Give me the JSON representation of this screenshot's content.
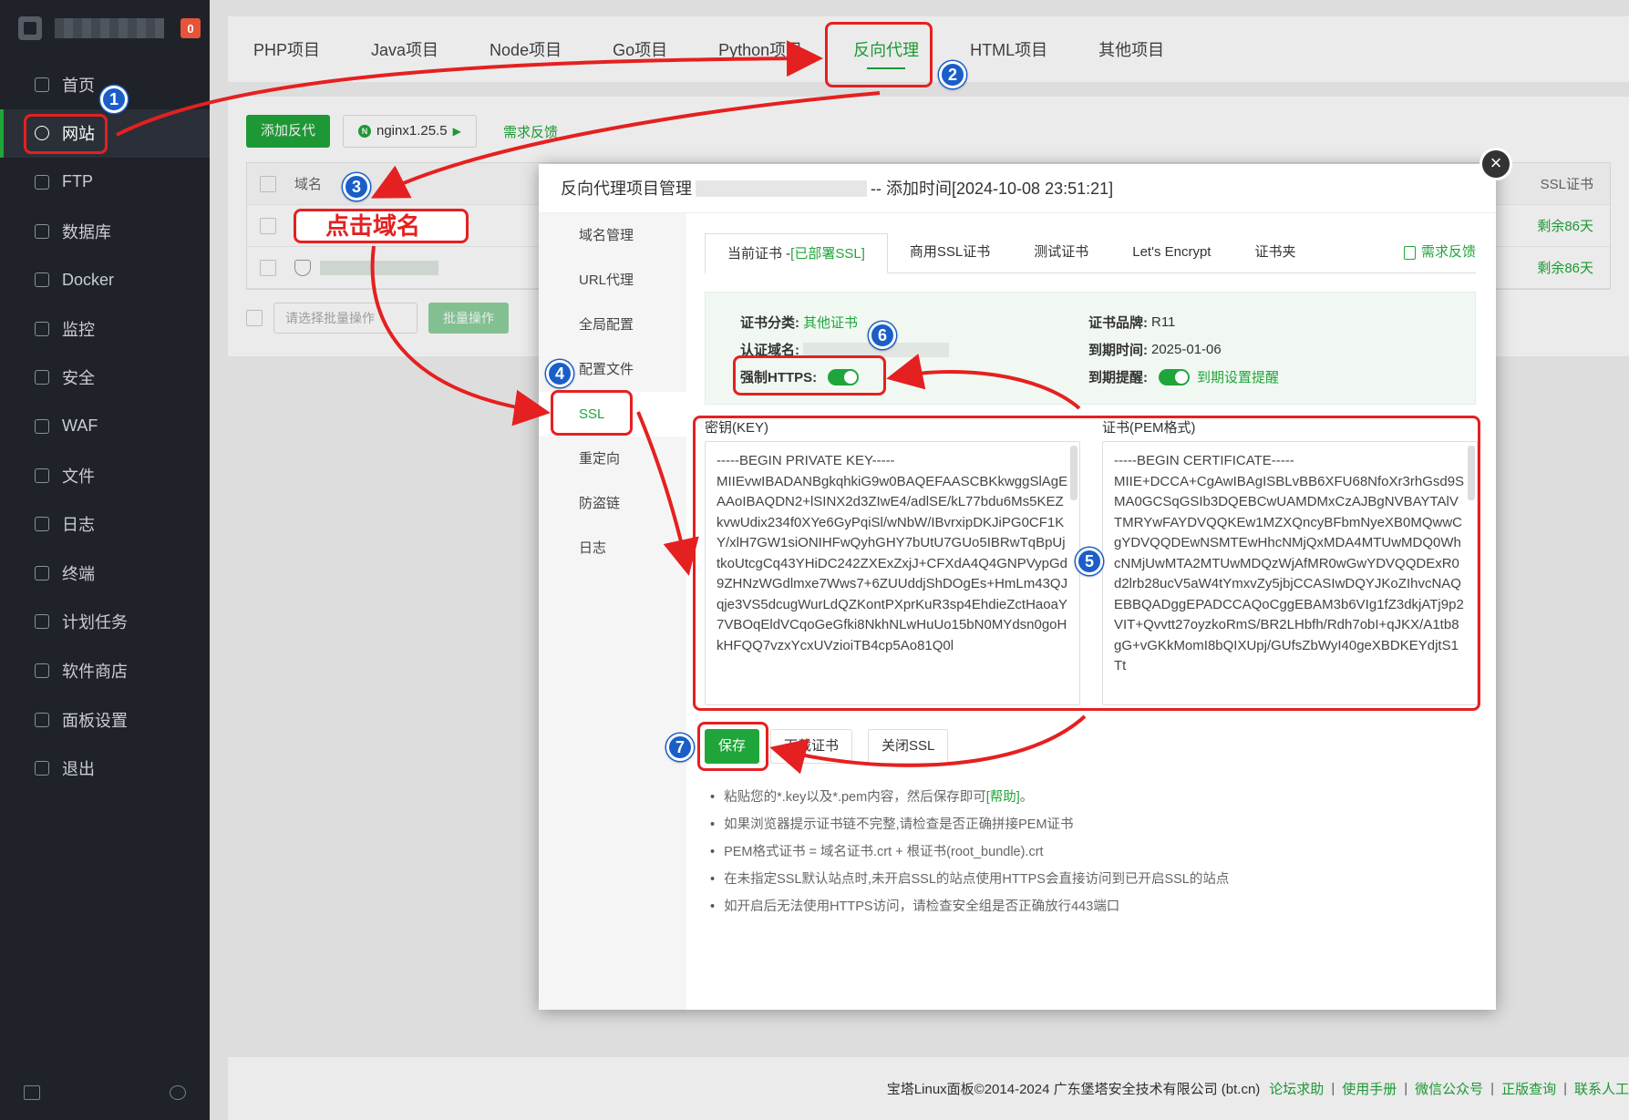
{
  "sidebar": {
    "badge": "0",
    "items": [
      {
        "label": "首页",
        "icon": "home-icon"
      },
      {
        "label": "网站",
        "icon": "globe-icon"
      },
      {
        "label": "FTP",
        "icon": "ftp-icon"
      },
      {
        "label": "数据库",
        "icon": "database-icon"
      },
      {
        "label": "Docker",
        "icon": "docker-icon"
      },
      {
        "label": "监控",
        "icon": "monitor-icon"
      },
      {
        "label": "安全",
        "icon": "shield-icon"
      },
      {
        "label": "WAF",
        "icon": "waf-icon"
      },
      {
        "label": "文件",
        "icon": "folder-icon"
      },
      {
        "label": "日志",
        "icon": "log-icon"
      },
      {
        "label": "终端",
        "icon": "terminal-icon"
      },
      {
        "label": "计划任务",
        "icon": "calendar-icon"
      },
      {
        "label": "软件商店",
        "icon": "grid-icon"
      },
      {
        "label": "面板设置",
        "icon": "gear-icon"
      },
      {
        "label": "退出",
        "icon": "logout-icon"
      }
    ]
  },
  "tabs": [
    "PHP项目",
    "Java项目",
    "Node项目",
    "Go项目",
    "Python项目",
    "反向代理",
    "HTML项目",
    "其他项目"
  ],
  "toolbar": {
    "add": "添加反代",
    "nginx": "nginx1.25.5",
    "feedback": "需求反馈"
  },
  "table": {
    "col_domain": "域名",
    "col_ssl": "SSL证书",
    "rows": [
      {
        "ssl": "剩余86天"
      },
      {
        "ssl": "剩余86天"
      }
    ]
  },
  "bulk": {
    "placeholder": "请选择批量操作",
    "button": "批量操作"
  },
  "modal": {
    "title_prefix": "反向代理项目管理",
    "title_suffix": "-- 添加时间[2024-10-08 23:51:21]",
    "side": [
      "域名管理",
      "URL代理",
      "全局配置",
      "配置文件",
      "SSL",
      "重定向",
      "防盗链",
      "日志"
    ],
    "ssl_tabs": {
      "current": "当前证书 -",
      "deployed": "[已部署SSL]",
      "others": [
        "商用SSL证书",
        "测试证书",
        "Let's Encrypt",
        "证书夹"
      ],
      "feedback": "需求反馈"
    },
    "info": {
      "category_label": "证书分类:",
      "category_value": "其他证书",
      "domain_label": "认证域名:",
      "https_label": "强制HTTPS:",
      "brand_label": "证书品牌:",
      "brand_value": "R11",
      "expire_label": "到期时间:",
      "expire_value": "2025-01-06",
      "remind_label": "到期提醒:",
      "remind_value": "到期设置提醒"
    },
    "key_label": "密钥(KEY)",
    "cert_label": "证书(PEM格式)",
    "key_text": "-----BEGIN PRIVATE KEY-----\nMIIEvwIBADANBgkqhkiG9w0BAQEFAASCBKkwggSlAgEAAoIBAQDN2+lSINX2d3ZIwE4/adlSE/kL77bdu6Ms5KEZkvwUdix234f0XYe6GyPqiSl/wNbW/IBvrxipDKJiPG0CF1KY/xlH7GW1siONIHFwQyhGHY7bUtU7GUo5IBRwTqBpUjtkoUtcgCq43YHiDC242ZXExZxjJ+CFXdA4Q4GNPVypGd9ZHNzWGdlmxe7Wws7+6ZUUddjShDOgEs+HmLm43QJqje3VS5dcugWurLdQZKontPXprKuR3sp4EhdieZctHaoaY7VBOqEldVCqoGeGfki8NkhNLwHuUo15bN0MYdsn0goHkHFQQ7vzxYcxUVzioiTB4cp5Ao81Q0l",
    "cert_text": "-----BEGIN CERTIFICATE-----\nMIIE+DCCA+CgAwIBAgISBLvBB6XFU68NfoXr3rhGsd9SMA0GCSqGSIb3DQEBCwUAMDMxCzAJBgNVBAYTAlVTMRYwFAYDVQQKEw1MZXQncyBFbmNyeXB0MQwwCgYDVQQDEwNSMTEwHhcNMjQxMDA4MTUwMDQ0WhcNMjUwMTA2MTUwMDQzWjAfMR0wGwYDVQQDExR0d2lrb28ucV5aW4tYmxvZy5jbjCCASIwDQYJKoZIhvcNAQEBBQADggEPADCCAQoCggEBAM3b6VIg1fZ3dkjATj9p2VIT+Qvvtt27oyzkoRmS/BR2LHbfh/Rdh7obI+qJKX/A1tb8gG+vGKkMomI8bQIXUpj/GUfsZbWyI40geXBDKEYdjtS1Tt"
  },
  "buttons": {
    "save": "保存",
    "download": "下载证书",
    "close_ssl": "关闭SSL"
  },
  "tips": [
    {
      "text": "粘贴您的*.key以及*.pem内容，然后保存即可",
      "link": "[帮助]",
      "after": "。"
    },
    {
      "text": "如果浏览器提示证书链不完整,请检查是否正确拼接PEM证书"
    },
    {
      "text": "PEM格式证书 = 域名证书.crt + 根证书(root_bundle).crt"
    },
    {
      "text": "在未指定SSL默认站点时,未开启SSL的站点使用HTTPS会直接访问到已开启SSL的站点"
    },
    {
      "text": "如开启后无法使用HTTPS访问，请检查安全组是否正确放行443端口"
    }
  ],
  "footer": {
    "copyright": "宝塔Linux面板©2014-2024 广东堡塔安全技术有限公司 (bt.cn)",
    "links": [
      "论坛求助",
      "使用手册",
      "微信公众号",
      "正版查询",
      "联系人工"
    ]
  },
  "annotations": {
    "callout": "点击域名",
    "numbers": [
      "1",
      "2",
      "3",
      "4",
      "5",
      "6",
      "7"
    ],
    "color": "#e52020",
    "badge_color": "#1a5fc7"
  }
}
